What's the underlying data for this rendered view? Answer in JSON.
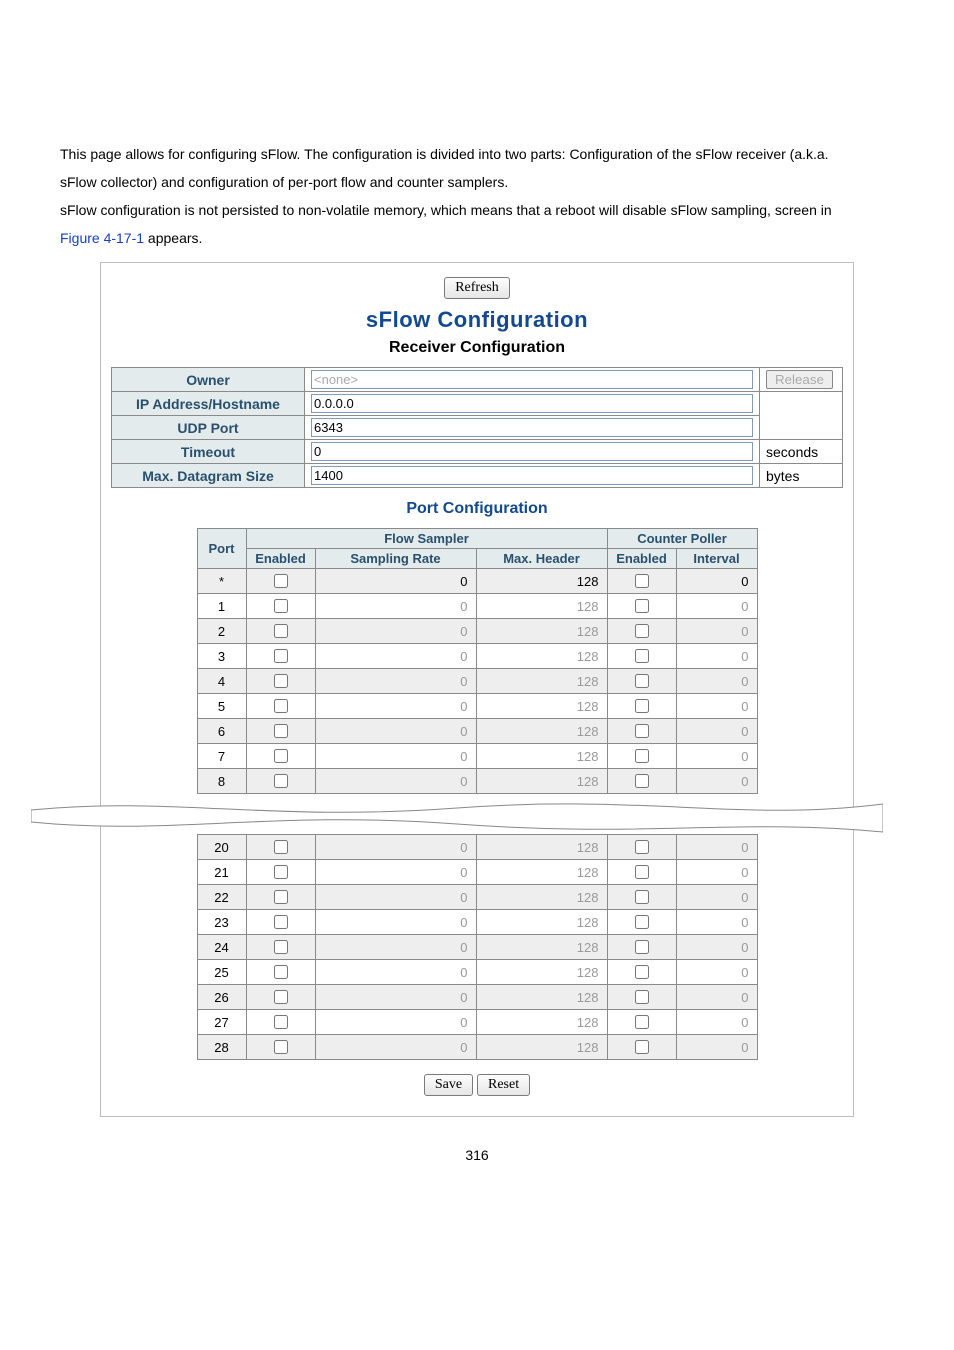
{
  "intro": {
    "p1a": "This page allows for configuring sFlow. The configuration is divided into two parts: Configuration of the sFlow receiver (a.k.a.",
    "p1b": "sFlow collector) and configuration of per-port flow and counter samplers.",
    "p2a": "sFlow configuration is not persisted to non-volatile memory, which means that a reboot will disable sFlow sampling, screen in",
    "figref": "Figure 4-17-1",
    "p2b": " appears."
  },
  "buttons": {
    "refresh": "Refresh",
    "release": "Release",
    "save": "Save",
    "reset": "Reset"
  },
  "titles": {
    "main": "sFlow Configuration",
    "receiver": "Receiver Configuration",
    "port": "Port Configuration"
  },
  "receiver": {
    "labels": {
      "owner": "Owner",
      "ip": "IP Address/Hostname",
      "udp": "UDP Port",
      "timeout": "Timeout",
      "maxdata": "Max. Datagram Size"
    },
    "values": {
      "owner": "<none>",
      "ip": "0.0.0.0",
      "udp": "6343",
      "timeout": "0",
      "maxdata": "1400"
    },
    "units": {
      "timeout": "seconds",
      "maxdata": "bytes"
    }
  },
  "port_headers": {
    "port": "Port",
    "flow": "Flow Sampler",
    "counter": "Counter Poller",
    "enabled": "Enabled",
    "rate": "Sampling Rate",
    "maxhdr": "Max. Header",
    "interval": "Interval"
  },
  "ports_top": [
    {
      "port": "*",
      "rate": "0",
      "hdr": "128",
      "intv": "0",
      "wild": true
    },
    {
      "port": "1",
      "rate": "0",
      "hdr": "128",
      "intv": "0"
    },
    {
      "port": "2",
      "rate": "0",
      "hdr": "128",
      "intv": "0"
    },
    {
      "port": "3",
      "rate": "0",
      "hdr": "128",
      "intv": "0"
    },
    {
      "port": "4",
      "rate": "0",
      "hdr": "128",
      "intv": "0"
    },
    {
      "port": "5",
      "rate": "0",
      "hdr": "128",
      "intv": "0"
    },
    {
      "port": "6",
      "rate": "0",
      "hdr": "128",
      "intv": "0"
    },
    {
      "port": "7",
      "rate": "0",
      "hdr": "128",
      "intv": "0"
    },
    {
      "port": "8",
      "rate": "0",
      "hdr": "128",
      "intv": "0"
    }
  ],
  "ports_bottom": [
    {
      "port": "20",
      "rate": "0",
      "hdr": "128",
      "intv": "0"
    },
    {
      "port": "21",
      "rate": "0",
      "hdr": "128",
      "intv": "0"
    },
    {
      "port": "22",
      "rate": "0",
      "hdr": "128",
      "intv": "0"
    },
    {
      "port": "23",
      "rate": "0",
      "hdr": "128",
      "intv": "0"
    },
    {
      "port": "24",
      "rate": "0",
      "hdr": "128",
      "intv": "0"
    },
    {
      "port": "25",
      "rate": "0",
      "hdr": "128",
      "intv": "0"
    },
    {
      "port": "26",
      "rate": "0",
      "hdr": "128",
      "intv": "0"
    },
    {
      "port": "27",
      "rate": "0",
      "hdr": "128",
      "intv": "0"
    },
    {
      "port": "28",
      "rate": "0",
      "hdr": "128",
      "intv": "0"
    }
  ],
  "page_number": "316"
}
